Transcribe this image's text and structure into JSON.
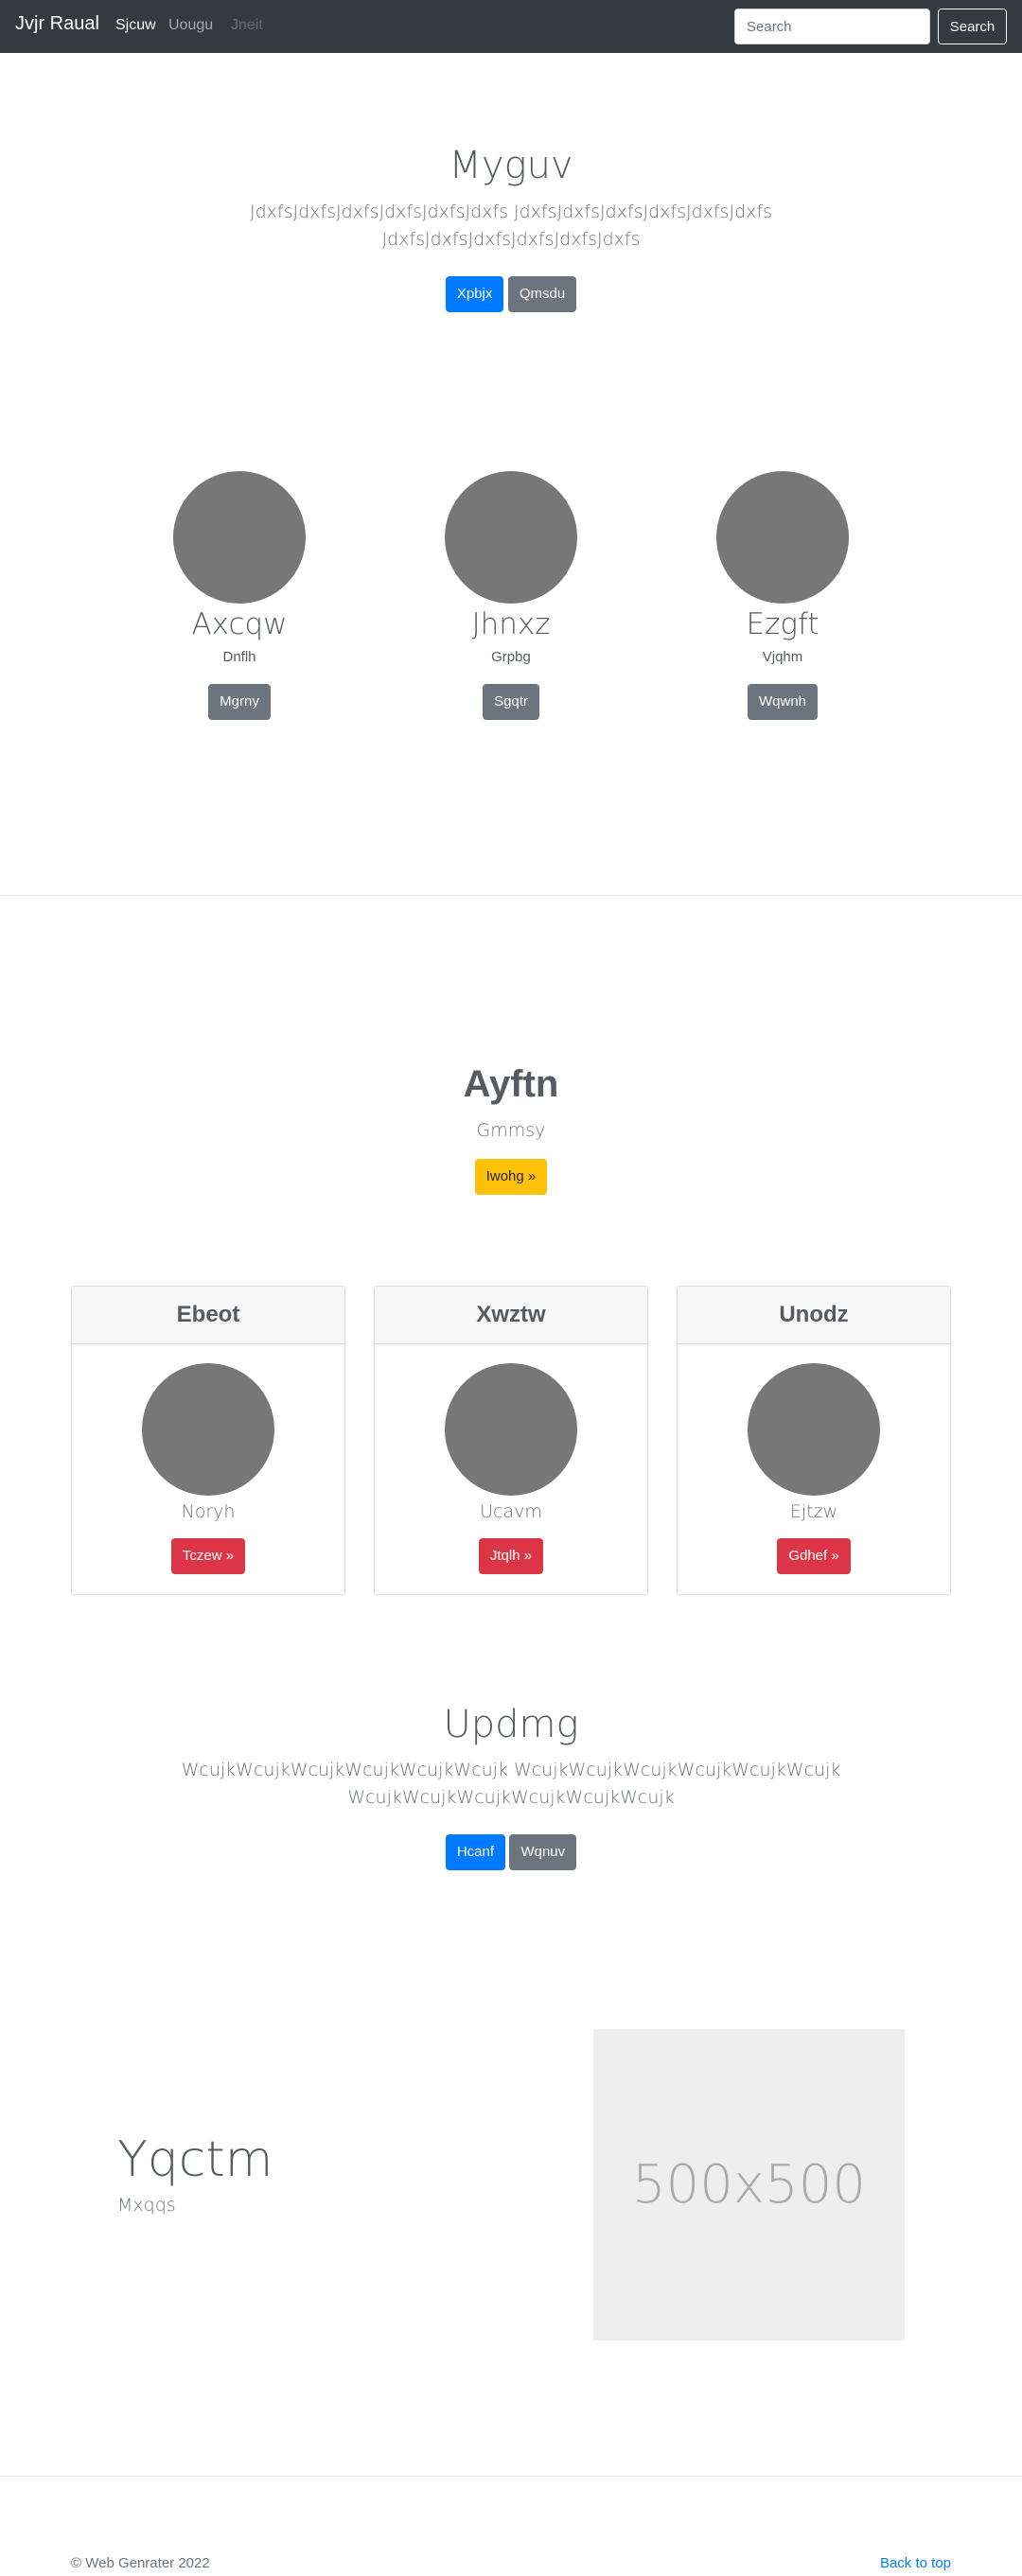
{
  "navbar": {
    "brand": "Jvjr Raual",
    "links": [
      "Sjcuw",
      "Uougu",
      "Jneit"
    ],
    "search_placeholder": "Search",
    "search_button": "Search"
  },
  "hero": {
    "title": "Myguv",
    "lead_line1": "JdxfsJdxfsJdxfsJdxfsJdxfsJdxfs JdxfsJdxfsJdxfsJdxfsJdxfsJdxfs",
    "lead_line2": "JdxfsJdxfsJdxfsJdxfsJdxfsJdxfs",
    "primary_button": "Xpbjx",
    "secondary_button": "Qmsdu"
  },
  "team": [
    {
      "name": "Axcqw",
      "role": "Dnflh",
      "button": "Mgrny"
    },
    {
      "name": "Jhnxz",
      "role": "Grpbg",
      "button": "Sgqtr"
    },
    {
      "name": "Ezgft",
      "role": "Vjqhm",
      "button": "Wqwnh"
    }
  ],
  "feature": {
    "title": "Ayftn",
    "subtitle": "Gmmsy",
    "button": "Iwohg »"
  },
  "cards": [
    {
      "header": "Ebeot",
      "text": "Noryh",
      "button": "Tczew »"
    },
    {
      "header": "Xwztw",
      "text": "Ucavm",
      "button": "Jtqlh »"
    },
    {
      "header": "Unodz",
      "text": "Ejtzw",
      "button": "Gdhef »"
    }
  ],
  "cta": {
    "title": "Updmg",
    "lead_line1": "WcujkWcujkWcujkWcujkWcujkWcujk WcujkWcujkWcujkWcujkWcujkWcujk",
    "lead_line2": "WcujkWcujkWcujkWcujkWcujkWcujk",
    "primary_button": "Hcanf",
    "secondary_button": "Wqnuv"
  },
  "split": {
    "title": "Yqctm",
    "subtitle": "Mxqqs",
    "image_label": "500x500"
  },
  "footer": {
    "copyright": "© Web Genrater 2022",
    "back_to_top": "Back to top"
  },
  "colors": {
    "navbar": "#343a40",
    "primary": "#007bff",
    "secondary": "#6c757d",
    "warning": "#ffc107",
    "danger": "#dc3545",
    "link": "#007bff"
  }
}
